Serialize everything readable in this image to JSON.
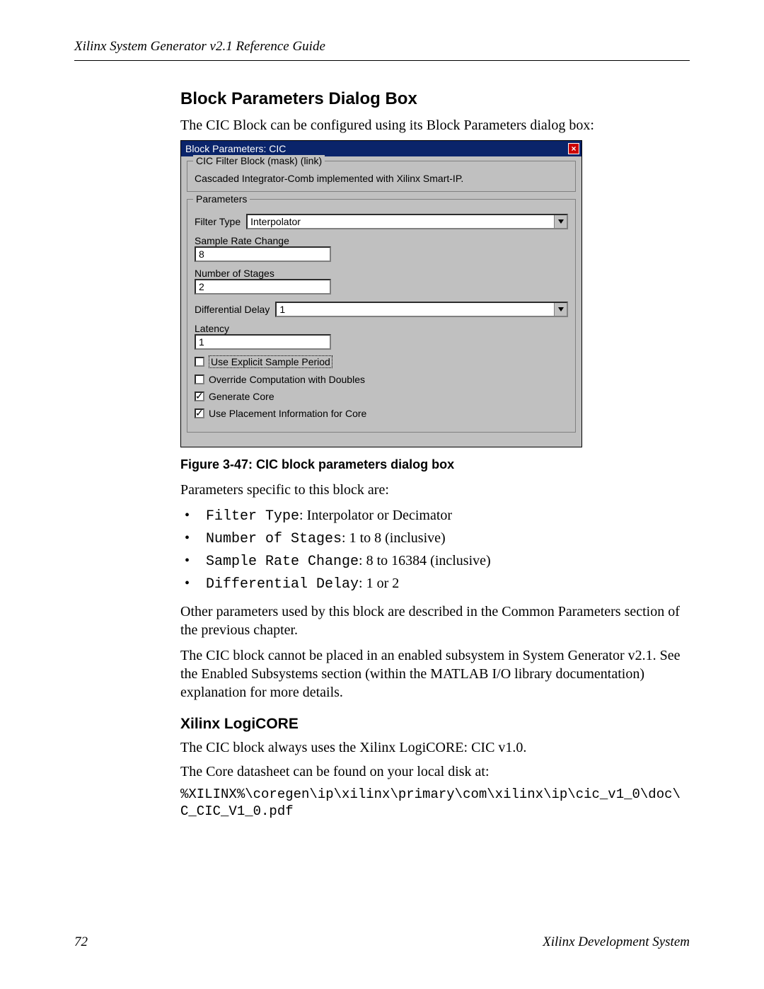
{
  "running_head": "Xilinx System Generator v2.1 Reference Guide",
  "section1_title": "Block Parameters Dialog Box",
  "section1_intro": "The CIC Block can be configured using its Block Parameters dialog box:",
  "dialog": {
    "title": "Block Parameters: CIC",
    "close_glyph": "×",
    "group_desc_legend": "CIC Filter Block (mask) (link)",
    "group_desc_text": "Cascaded Integrator-Comb implemented with Xilinx Smart-IP.",
    "group_params_legend": "Parameters",
    "filter_type_label": "Filter Type",
    "filter_type_value": "Interpolator",
    "sample_rate_label": "Sample Rate Change",
    "sample_rate_value": "8",
    "num_stages_label": "Number of Stages",
    "num_stages_value": "2",
    "diff_delay_label": "Differential Delay",
    "diff_delay_value": "1",
    "latency_label": "Latency",
    "latency_value": "1",
    "cb_explicit": "Use Explicit Sample Period",
    "cb_override": "Override Computation with Doubles",
    "cb_generate": "Generate Core",
    "cb_placement": "Use Placement Information for Core"
  },
  "figure_caption": "Figure 3-47:   CIC block parameters dialog box",
  "params_intro": "Parameters specific to this block are:",
  "bullets": {
    "b1_code": "Filter Type",
    "b1_rest": ": Interpolator or Decimator",
    "b2_code": "Number of Stages",
    "b2_rest": ": 1 to 8 (inclusive)",
    "b3_code": "Sample Rate Change",
    "b3_rest": ": 8 to 16384 (inclusive)",
    "b4_code": "Differential Delay",
    "b4_rest": ": 1 or 2"
  },
  "para_other": "Other parameters used by this block are described in the Common Parameters section of the previous chapter.",
  "para_enabled": "The CIC block cannot be placed in an enabled subsystem in System Generator v2.1. See the Enabled Subsystems section (within the MATLAB I/O library documentation) explanation for more details.",
  "section2_title": "Xilinx LogiCORE",
  "logicore_p1": "The CIC block always uses the Xilinx LogiCORE: CIC v1.0.",
  "logicore_p2": "The Core datasheet can be found on your local disk at:",
  "logicore_path": "%XILINX%\\coregen\\ip\\xilinx\\primary\\com\\xilinx\\ip\\cic_v1_0\\doc\\\nC_CIC_V1_0.pdf",
  "footer": {
    "page": "72",
    "system": "Xilinx Development System"
  }
}
